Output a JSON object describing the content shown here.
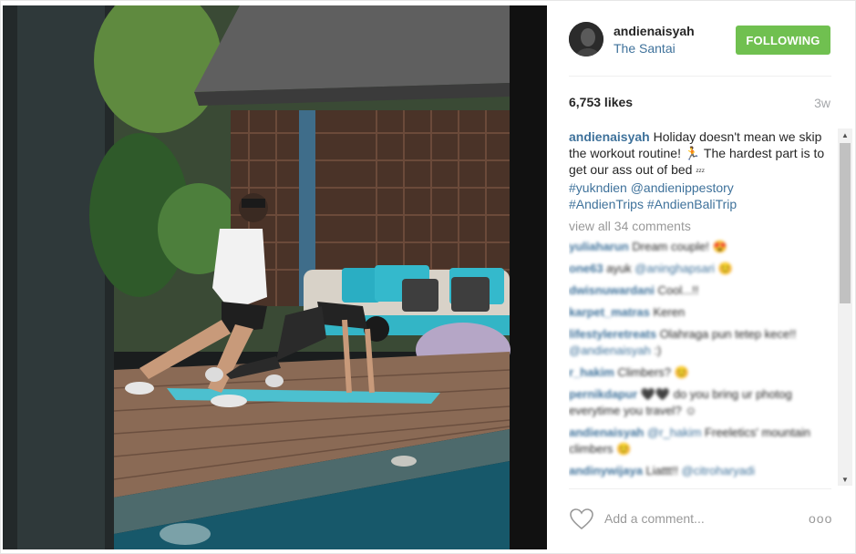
{
  "post": {
    "username": "andienaisyah",
    "location": "The Santai",
    "follow_label": "FOLLOWING",
    "likes": "6,753 likes",
    "age": "3w"
  },
  "caption": {
    "username": "andienaisyah",
    "text_1": " Holiday doesn't mean we skip the workout routine! ",
    "emoji_1": "🏃",
    "text_2": " The hardest part is to get our ass out of bed ",
    "emoji_2": "ᶻᶻᶻ",
    "tag_1": "#yukndien",
    "tag_2": "@andienippestory",
    "tag_3": "#AndienTrips",
    "tag_4": "#AndienBaliTrip"
  },
  "view_all": "view all 34 comments",
  "comments": [
    {
      "user": "yuliaharun",
      "text": "Dream couple! ",
      "mention": "",
      "tail": "😍"
    },
    {
      "user": "one63",
      "text": "ayuk ",
      "mention": "@aninghapsari",
      "tail": " 😊"
    },
    {
      "user": "dwisnuwardani",
      "text": "Cool...!!",
      "mention": "",
      "tail": ""
    },
    {
      "user": "karpet_matras",
      "text": "Keren",
      "mention": "",
      "tail": ""
    },
    {
      "user": "lifestyleretreats",
      "text": "Olahraga pun tetep kece!! ",
      "mention": "@andienaisyah",
      "tail": " :)"
    },
    {
      "user": "r_hakim",
      "text": "Climbers? ",
      "mention": "",
      "tail": "😊"
    },
    {
      "user": "pernikdapur",
      "text": "🖤🖤 do you bring ur photog everytime you travel? ",
      "mention": "",
      "tail": "☺"
    },
    {
      "user": "andienaisyah",
      "text": "",
      "mention": "@r_hakim",
      "tail": " Freeletics' mountain climbers 😊"
    },
    {
      "user": "andinywijaya",
      "text": "Liattt!! ",
      "mention": "@citroharyadi",
      "tail": ""
    }
  ],
  "footer": {
    "add_comment_placeholder": "Add a comment...",
    "more_label": "ooo"
  },
  "scrollbar": {
    "up_arrow": "▲",
    "down_arrow": "▼"
  },
  "icons": {
    "heart": "heart-icon",
    "more": "more-options-icon"
  },
  "colors": {
    "follow_green": "#70c050",
    "link_blue": "#3f729b",
    "muted_grey": "#999999"
  }
}
